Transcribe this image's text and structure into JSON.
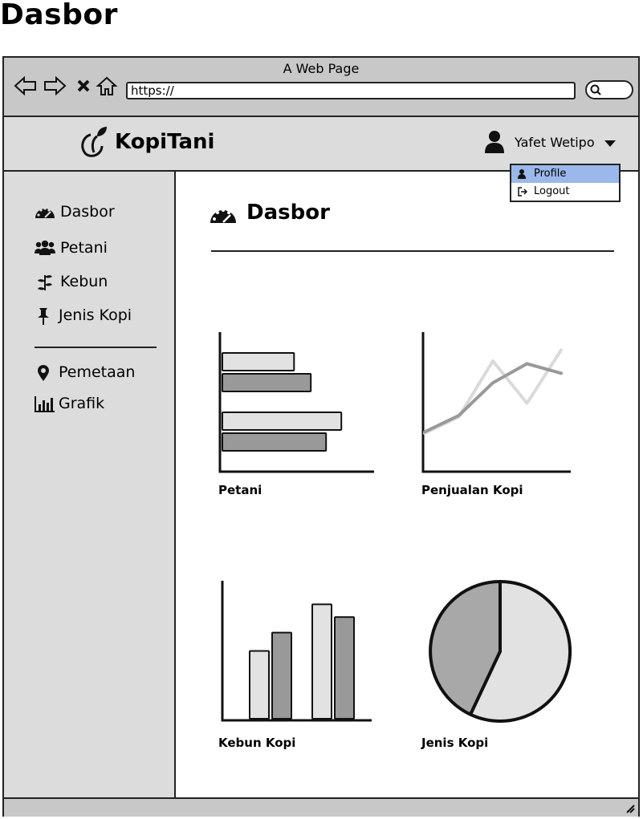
{
  "page": {
    "title": "Dasbor"
  },
  "browser": {
    "window_title": "A Web Page",
    "nav": {
      "back_icon": "back-arrow-icon",
      "forward_icon": "forward-arrow-icon",
      "stop_icon": "close-icon",
      "home_icon": "home-icon"
    },
    "address": "https://",
    "search_icon": "search-icon"
  },
  "header": {
    "brand": "KopiTani",
    "logo_icon": "coffee-leaf-icon",
    "user_name": "Yafet Wetipo",
    "user_icon": "user-icon",
    "dropdown": [
      {
        "label": "Profile",
        "icon": "user-icon",
        "highlighted": true
      },
      {
        "label": "Logout",
        "icon": "logout-icon",
        "highlighted": false
      }
    ]
  },
  "sidebar": {
    "items": [
      {
        "label": "Dasbor",
        "icon": "dashboard-icon"
      },
      {
        "label": "Petani",
        "icon": "users-icon"
      },
      {
        "label": "Kebun",
        "icon": "plant-icon"
      },
      {
        "label": "Jenis Kopi",
        "icon": "pin-icon"
      }
    ],
    "items2": [
      {
        "label": "Pemetaan",
        "icon": "map-marker-icon"
      },
      {
        "label": "Grafik",
        "icon": "bar-chart-icon"
      }
    ]
  },
  "main": {
    "heading": "Dasbor",
    "heading_icon": "dashboard-icon"
  },
  "colors": {
    "chrome": "#c8c8c8",
    "panel": "#dcdcdc",
    "highlight": "#9bb8ea",
    "bar_light": "#e2e2e2",
    "bar_dark": "#999999"
  },
  "chart_data": [
    {
      "type": "bar",
      "orientation": "horizontal",
      "title": "Petani",
      "categories": [
        "",
        ""
      ],
      "series": [
        {
          "values": [
            0.47,
            0.78
          ]
        },
        {
          "values": [
            0.58,
            0.68
          ]
        }
      ]
    },
    {
      "type": "line",
      "title": "Penjualan Kopi",
      "x": [
        0,
        1,
        2,
        3,
        4
      ],
      "series": [
        {
          "values": [
            0.27,
            0.39,
            0.8,
            0.49,
            0.88
          ]
        },
        {
          "values": [
            0.28,
            0.4,
            0.64,
            0.78,
            0.71
          ]
        }
      ]
    },
    {
      "type": "bar",
      "title": "Kebun Kopi",
      "categories": [
        "",
        ""
      ],
      "series": [
        {
          "values": [
            0.48,
            0.81
          ]
        },
        {
          "values": [
            0.61,
            0.72
          ]
        }
      ]
    },
    {
      "type": "pie",
      "title": "Jenis Kopi",
      "slices": [
        {
          "value": 57
        },
        {
          "value": 43
        }
      ]
    }
  ]
}
